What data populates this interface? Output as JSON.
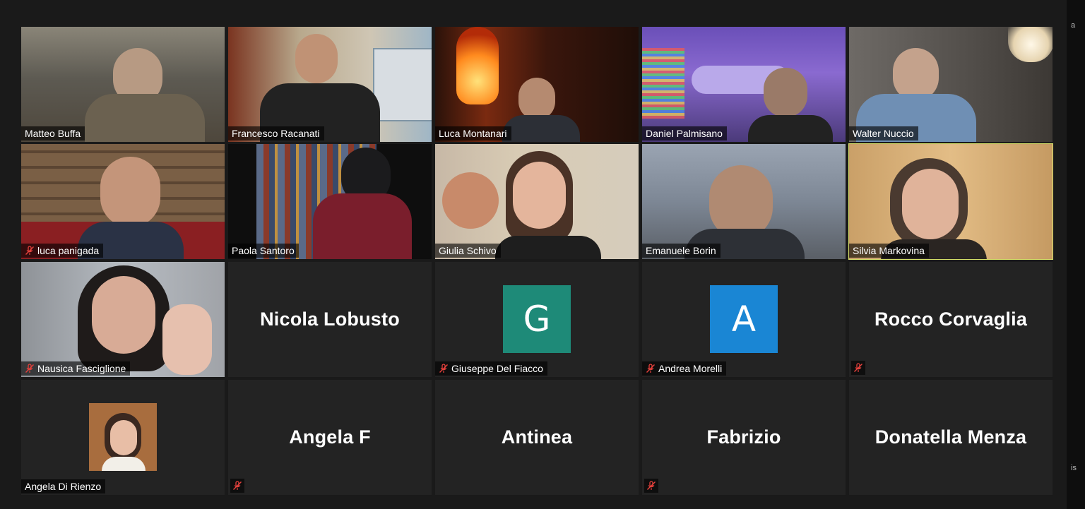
{
  "window": {
    "side_text_top": "a",
    "side_text_bottom": "is"
  },
  "participants": [
    {
      "name": "Matteo Buffa",
      "muted": false,
      "type": "video"
    },
    {
      "name": "Francesco Racanati",
      "muted": false,
      "type": "video"
    },
    {
      "name": "Luca Montanari",
      "muted": false,
      "type": "video"
    },
    {
      "name": "Daniel Palmisano",
      "muted": false,
      "type": "video"
    },
    {
      "name": "Walter Nuccio",
      "muted": false,
      "type": "video"
    },
    {
      "name": "luca panigada",
      "muted": true,
      "type": "video"
    },
    {
      "name": "Paola Santoro",
      "muted": false,
      "type": "video"
    },
    {
      "name": "Giulia Schivo",
      "muted": false,
      "type": "video"
    },
    {
      "name": "Emanuele Borin",
      "muted": false,
      "type": "video"
    },
    {
      "name": "Silvia Markovina",
      "muted": false,
      "type": "video",
      "active_speaker": true
    },
    {
      "name": "Nausica Fasciglione",
      "muted": true,
      "type": "video"
    },
    {
      "name": "Nicola Lobusto",
      "muted": false,
      "type": "name"
    },
    {
      "name": "Giuseppe Del Fiacco",
      "muted": true,
      "type": "letter-avatar",
      "initial": "G",
      "avatar_color": "#1e8a78"
    },
    {
      "name": "Andrea Morelli",
      "muted": true,
      "type": "letter-avatar",
      "initial": "A",
      "avatar_color": "#1a86d4"
    },
    {
      "name": "Rocco Corvaglia",
      "muted": true,
      "type": "name"
    },
    {
      "name": "Angela Di Rienzo",
      "muted": false,
      "type": "photo-avatar"
    },
    {
      "name": "Angela F",
      "muted": true,
      "type": "name"
    },
    {
      "name": "Antinea",
      "muted": false,
      "type": "name"
    },
    {
      "name": "Fabrizio",
      "muted": true,
      "type": "name"
    },
    {
      "name": "Donatella Menza",
      "muted": false,
      "type": "name"
    }
  ],
  "colors": {
    "active_speaker_border": "#d7e26a",
    "muted_icon": "#e5413c",
    "tile_bg": "#232323"
  },
  "icons": {
    "muted": "mic-off-icon"
  }
}
